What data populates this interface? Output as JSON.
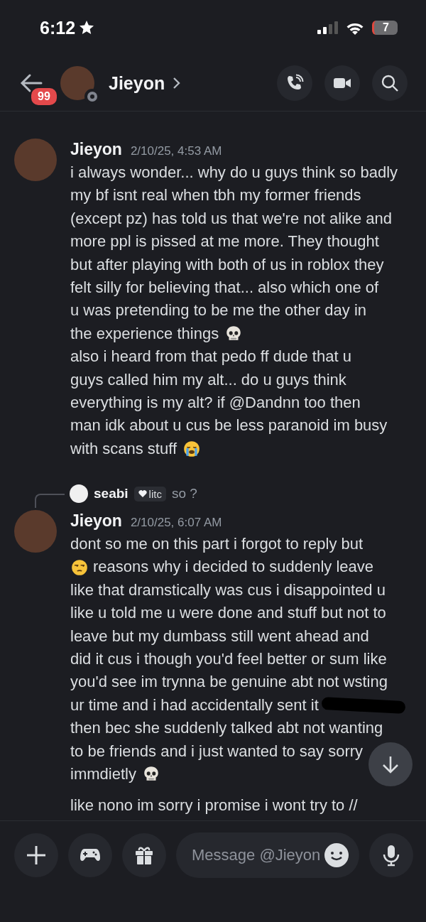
{
  "status_bar": {
    "time": "6:12",
    "battery": "7"
  },
  "header": {
    "unread_badge": "99",
    "name": "Jieyon"
  },
  "messages": [
    {
      "kind": "group",
      "author": "Jieyon",
      "timestamp": "2/10/25, 4:53 AM",
      "lines": [
        [
          {
            "kind": "text",
            "text": "i always wonder... why do u guys think so badly"
          }
        ],
        [
          {
            "kind": "text",
            "text": "my bf isnt real when tbh my former friends"
          }
        ],
        [
          {
            "kind": "text",
            "text": "(except pz) has told us that we're not alike and"
          }
        ],
        [
          {
            "kind": "text",
            "text": "more ppl is pissed at me more. They thought"
          }
        ],
        [
          {
            "kind": "text",
            "text": "but after playing with both of us in roblox they"
          }
        ],
        [
          {
            "kind": "text",
            "text": "felt silly for believing that... also which one of"
          }
        ],
        [
          {
            "kind": "text",
            "text": "u was pretending to be me the other day in"
          }
        ],
        [
          {
            "kind": "text",
            "text": "the experience things"
          },
          {
            "kind": "skull"
          }
        ],
        [
          {
            "kind": "text",
            "text": "also i heard from that pedo ff dude that u"
          }
        ],
        [
          {
            "kind": "text",
            "text": "guys called him my alt... do u guys think"
          }
        ],
        [
          {
            "kind": "text",
            "text": "everything is my alt? if @Dandnn too then"
          }
        ],
        [
          {
            "kind": "text",
            "text": "man idk about u cus be less paranoid im busy"
          }
        ],
        [
          {
            "kind": "text",
            "text": "with scans stuff"
          },
          {
            "kind": "sob"
          }
        ]
      ]
    },
    {
      "kind": "group",
      "author": "Jieyon",
      "timestamp": "2/10/25, 6:07 AM",
      "reply": {
        "author": "seabi",
        "tag": "litc",
        "text": "so ?"
      },
      "lines": [
        [
          {
            "kind": "text",
            "text": "dont so me on this part i forgot to reply but"
          }
        ],
        [
          {
            "kind": "unamused"
          },
          {
            "kind": "text",
            "text": "reasons why i decided to suddenly leave"
          }
        ],
        [
          {
            "kind": "text",
            "text": "like that dramstically was cus i disappointed u"
          }
        ],
        [
          {
            "kind": "text",
            "text": "like u told me u were done and stuff but not to"
          }
        ],
        [
          {
            "kind": "text",
            "text": "leave but my dumbass still went ahead and"
          }
        ],
        [
          {
            "kind": "text",
            "text": "did it cus i though you'd feel better or sum like"
          }
        ],
        [
          {
            "kind": "text",
            "text": "you'd see im trynna be genuine abt not wsting"
          }
        ],
        [
          {
            "kind": "text",
            "text": "ur time and i had accidentally sent it"
          },
          {
            "kind": "redaction"
          }
        ],
        [
          {
            "kind": "text",
            "text": "then bec she suddenly talked abt not wanting"
          }
        ],
        [
          {
            "kind": "text",
            "text": "to be friends and i just wanted to say sorry"
          }
        ],
        [
          {
            "kind": "text",
            "text": "immdietly"
          },
          {
            "kind": "skull"
          }
        ]
      ]
    },
    {
      "kind": "continuation",
      "lines": [
        [
          {
            "kind": "text",
            "text": "like nono im sorry i promise i wont try to //"
          }
        ]
      ]
    }
  ],
  "composer": {
    "placeholder": "Message @Jieyon"
  }
}
